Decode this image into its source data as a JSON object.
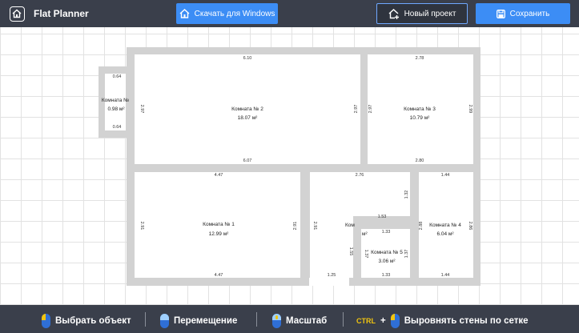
{
  "header": {
    "app_title": "Flat Planner",
    "download_label": "Скачать для Windows",
    "new_project_label": "Новый проект",
    "save_label": "Сохранить"
  },
  "rooms": [
    {
      "id": "r0",
      "name": "Комната №",
      "area": "0.98 м²"
    },
    {
      "id": "r2",
      "name": "Комната № 2",
      "area": "18.07 м²"
    },
    {
      "id": "r3",
      "name": "Комната № 3",
      "area": "10.79 м²"
    },
    {
      "id": "r1",
      "name": "Комната № 1",
      "area": "12.99 м²"
    },
    {
      "id": "r4",
      "name": "Комната № 4",
      "area": "6.04 м²"
    },
    {
      "id": "r5",
      "name": "Комната № 5",
      "area": "3.06 м²"
    },
    {
      "id": "r6",
      "name": "Ком",
      "area": "м²"
    }
  ],
  "dimensions": {
    "d064_top": "0.64",
    "d064_bot": "0.64",
    "d610": "6.10",
    "d607": "6.07",
    "d297_l": "2.97",
    "d297_r": "2.97",
    "d297_l3": "2.97",
    "d299": "2.99",
    "d278": "2.78",
    "d280": "2.80",
    "d447_t": "4.47",
    "d447_b": "4.47",
    "d291_l": "2.91",
    "d291_r": "2.91",
    "d291_k": "2.91",
    "d276": "2.76",
    "d132": "1.32",
    "d153": "1.53",
    "d133_a": "1.33",
    "d133_b": "1.33",
    "d137_a": "1.37",
    "d137_b": "1.37",
    "d155": "1.55",
    "d125": "1.25",
    "d144_t": "1.44",
    "d144_b": "1.44",
    "d288": "2.88",
    "d286": "2.86"
  },
  "footer": {
    "select_object": "Выбрать объект",
    "move": "Перемещение",
    "zoom": "Масштаб",
    "ctrl_key": "CTRL",
    "plus": "+",
    "align_walls": "Выровнять стены по сетке"
  },
  "colors": {
    "wall": "#d2d2d2",
    "accent": "#3c8df5",
    "bar": "#3a3f4b"
  }
}
